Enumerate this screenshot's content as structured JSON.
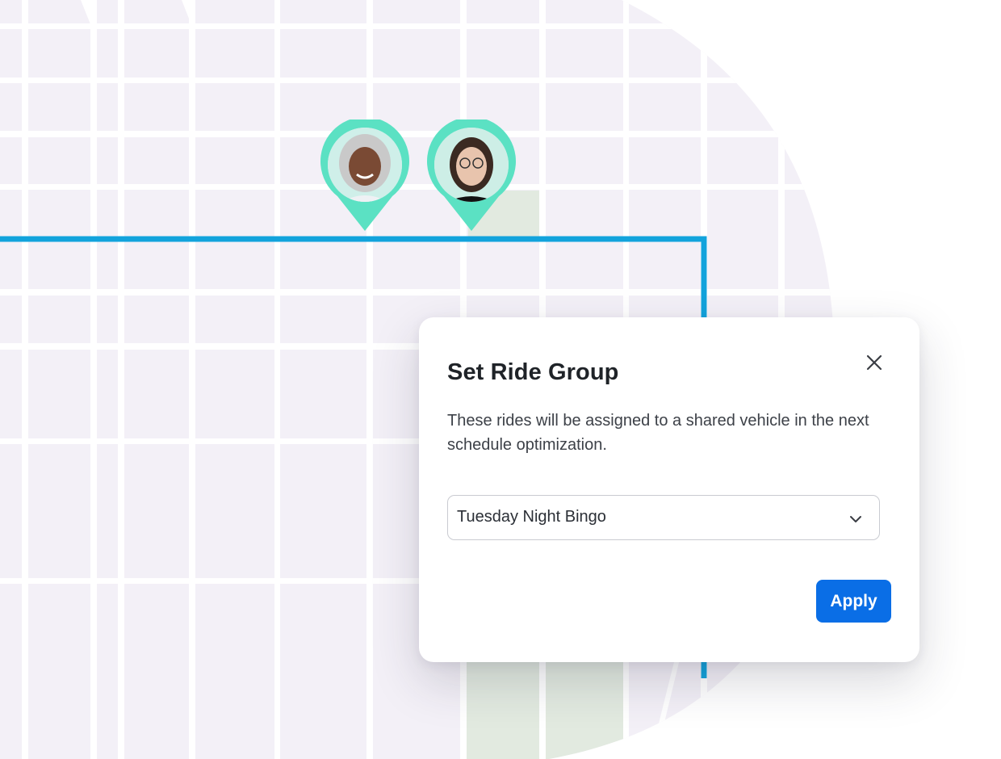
{
  "dialog": {
    "title": "Set Ride Group",
    "description": "These rides will be assigned to a shared vehicle in the next schedule optimization.",
    "ride_group_select": {
      "selected": "Tuesday Night Bingo"
    },
    "apply_label": "Apply",
    "close_icon": "close-icon"
  },
  "map": {
    "riders": [
      {
        "icon": "rider-avatar-pin"
      },
      {
        "icon": "rider-avatar-pin"
      }
    ]
  },
  "colors": {
    "map_background": "#f3f0f7",
    "street": "#ffffff",
    "route": "#12a3dc",
    "park": "#e2eae0",
    "pin": "#5be1c3",
    "accent_button": "#0a6ee6",
    "title_text": "#1f2328"
  }
}
